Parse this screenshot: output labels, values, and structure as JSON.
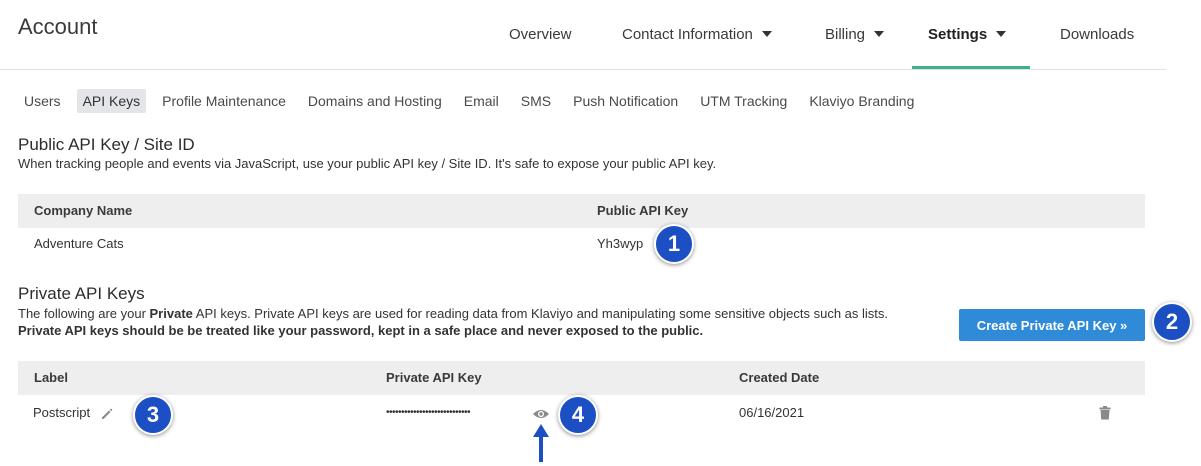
{
  "header": {
    "title": "Account",
    "nav": [
      {
        "label": "Overview"
      },
      {
        "label": "Contact Information"
      },
      {
        "label": "Billing"
      },
      {
        "label": "Settings"
      },
      {
        "label": "Downloads"
      }
    ],
    "active_nav": "Settings"
  },
  "subnav": {
    "items": [
      "Users",
      "API Keys",
      "Profile Maintenance",
      "Domains and Hosting",
      "Email",
      "SMS",
      "Push Notification",
      "UTM Tracking",
      "Klaviyo Branding"
    ],
    "selected": "API Keys"
  },
  "public_section": {
    "title": "Public API Key / Site ID",
    "description": "When tracking people and events via JavaScript, use your public API key / Site ID. It's safe to expose your public API key.",
    "columns": [
      "Company Name",
      "Public API Key"
    ],
    "row": {
      "company": "Adventure Cats",
      "key": "Yh3wyp"
    }
  },
  "private_section": {
    "title": "Private API Keys",
    "desc_part1": "The following are your ",
    "desc_bold1": "Private",
    "desc_part2": " API keys. Private API keys are used for reading data from Klaviyo and manipulating some sensitive objects such as lists.",
    "desc_bold2": "Private API keys should be be treated like your password, kept in a safe place and never exposed to the public.",
    "create_button": "Create Private API Key »",
    "columns": [
      "Label",
      "Private API Key",
      "Created Date"
    ],
    "row": {
      "label": "Postscript",
      "key_masked": "••••••••••••••••••••••••••••",
      "created": "06/16/2021"
    }
  },
  "annotations": {
    "badges": [
      "1",
      "2",
      "3",
      "4"
    ],
    "badge_color": "#1c4fc4"
  },
  "icons": [
    "caret-down-icon",
    "pencil-icon",
    "eye-icon",
    "trash-icon",
    "arrow-up-icon"
  ],
  "colors": {
    "accent_underline": "#3fb08e",
    "button": "#2f8ad8",
    "table_header": "#eeeeee"
  }
}
